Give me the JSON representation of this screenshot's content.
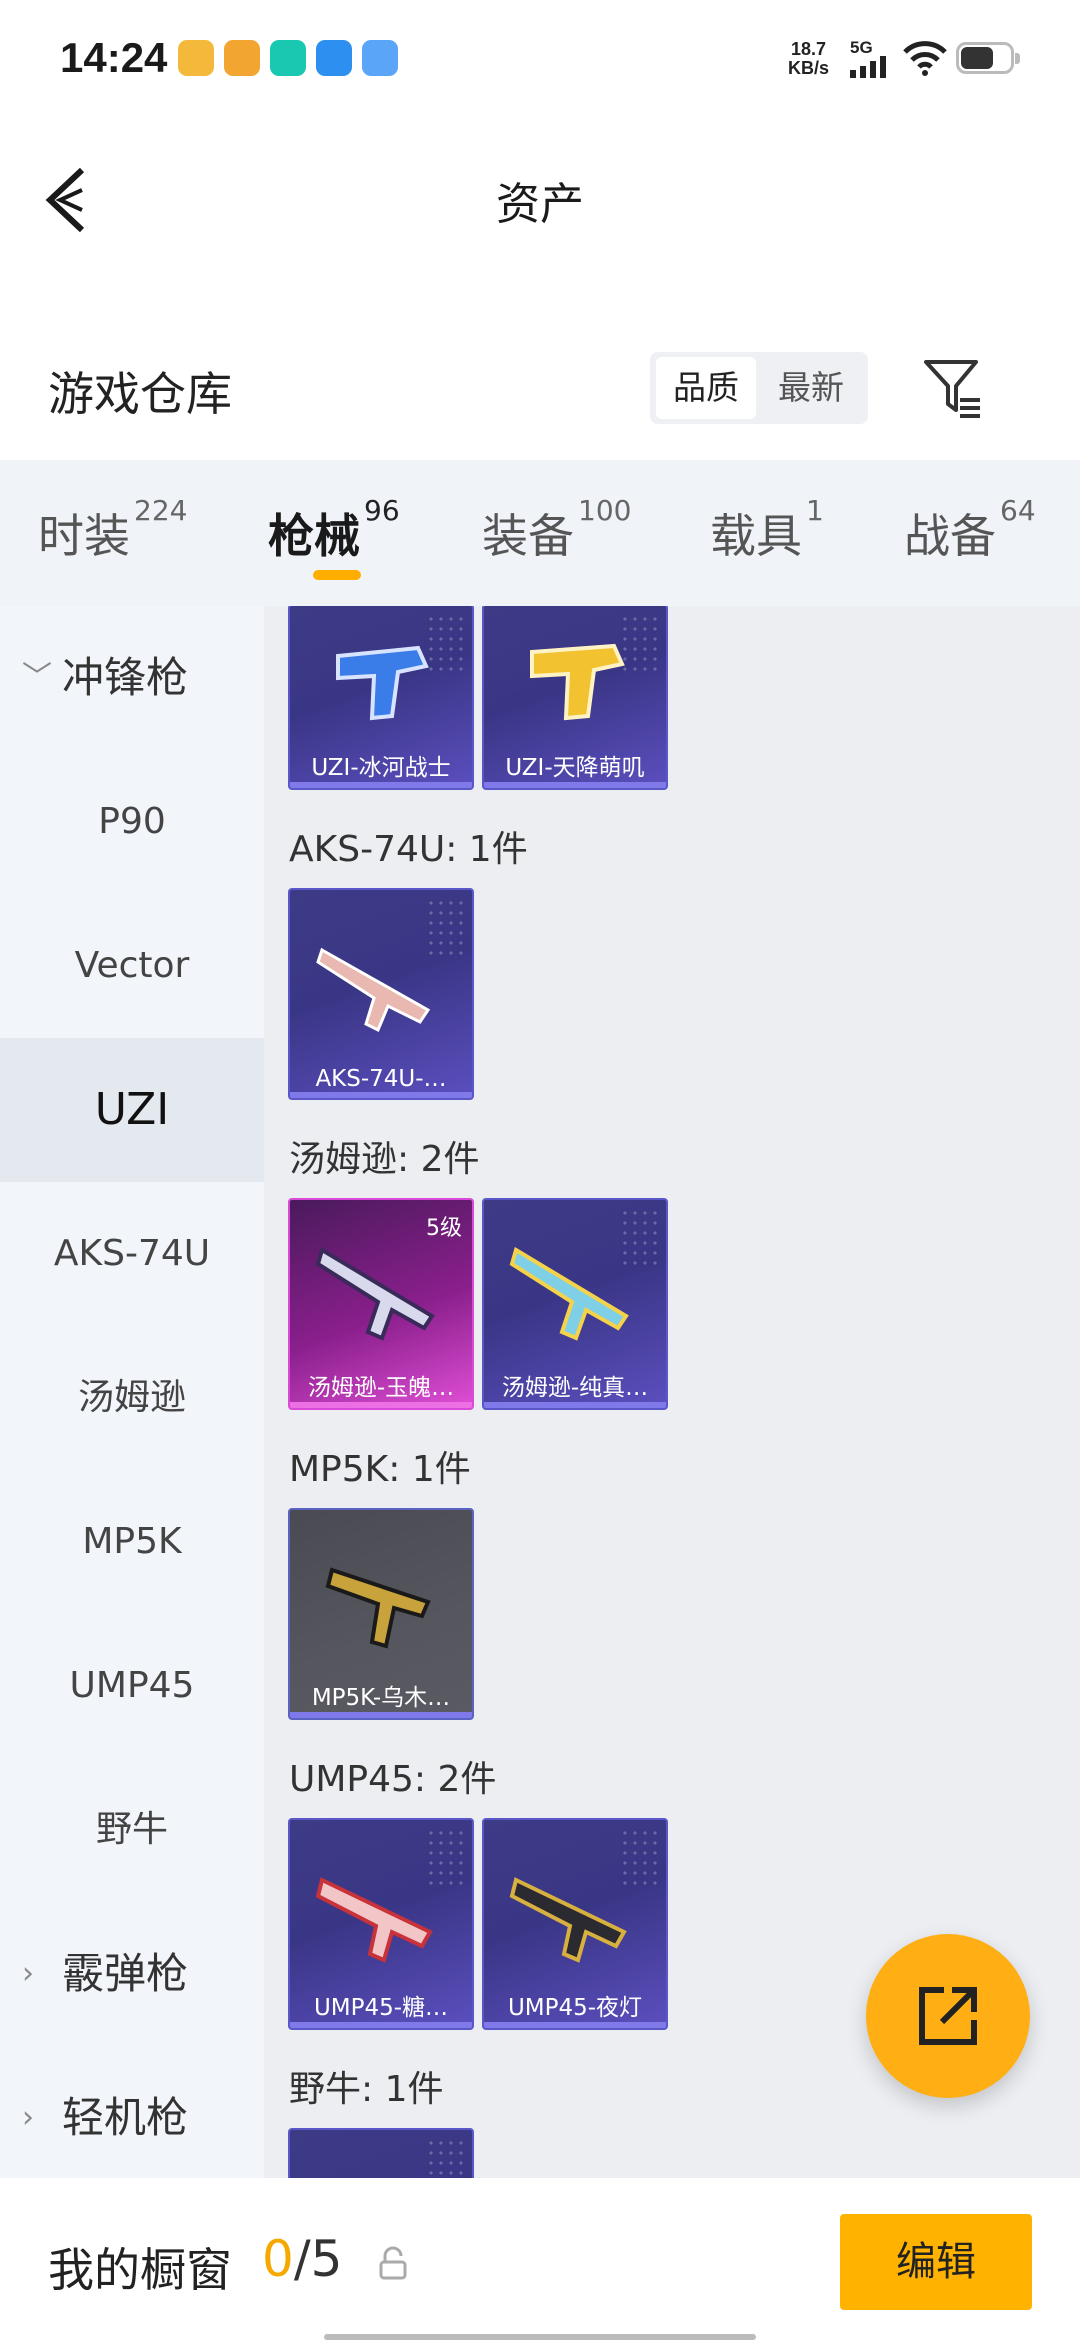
{
  "status_bar": {
    "time": "14:24",
    "net_rate_value": "18.7",
    "net_rate_unit": "KB/s",
    "network": "5G"
  },
  "header": {
    "title": "资产"
  },
  "section": {
    "title": "游戏仓库",
    "sort_options": [
      "品质",
      "最新"
    ],
    "selected_sort": "品质"
  },
  "tabs": [
    {
      "label": "时装",
      "count": "224"
    },
    {
      "label": "枪械",
      "count": "96",
      "active": true
    },
    {
      "label": "装备",
      "count": "100"
    },
    {
      "label": "载具",
      "count": "1"
    },
    {
      "label": "战备",
      "count": "64"
    }
  ],
  "sidebar": {
    "group": "冲锋枪",
    "items": [
      "P90",
      "Vector",
      "UZI",
      "AKS-74U",
      "汤姆逊",
      "MP5K",
      "UMP45",
      "野牛"
    ],
    "active": "UZI",
    "groups_collapsed": [
      "霰弹枪",
      "轻机枪"
    ]
  },
  "content": {
    "uzi_items": [
      "UZI-冰河战士",
      "UZI-天降萌叽"
    ],
    "categories": [
      {
        "header": "AKS-74U: 1件",
        "items": [
          "AKS-74U-…"
        ]
      },
      {
        "header": "汤姆逊: 2件",
        "items": [
          "汤姆逊-玉魄…",
          "汤姆逊-纯真…"
        ],
        "level_badge": "5级"
      },
      {
        "header": "MP5K: 1件",
        "items": [
          "MP5K-乌木…"
        ]
      },
      {
        "header": "UMP45: 2件",
        "items": [
          "UMP45-糖…",
          "UMP45-夜灯"
        ]
      },
      {
        "header": "野牛: 1件",
        "items": []
      }
    ]
  },
  "bottom_bar": {
    "label": "我的橱窗",
    "current": "0",
    "total": "/5",
    "edit_label": "编辑"
  },
  "colors": {
    "accent": "#ffae00",
    "card_purple": "#3d3b86",
    "card_pink": "#8a1f8c",
    "card_gray": "#56565e"
  }
}
